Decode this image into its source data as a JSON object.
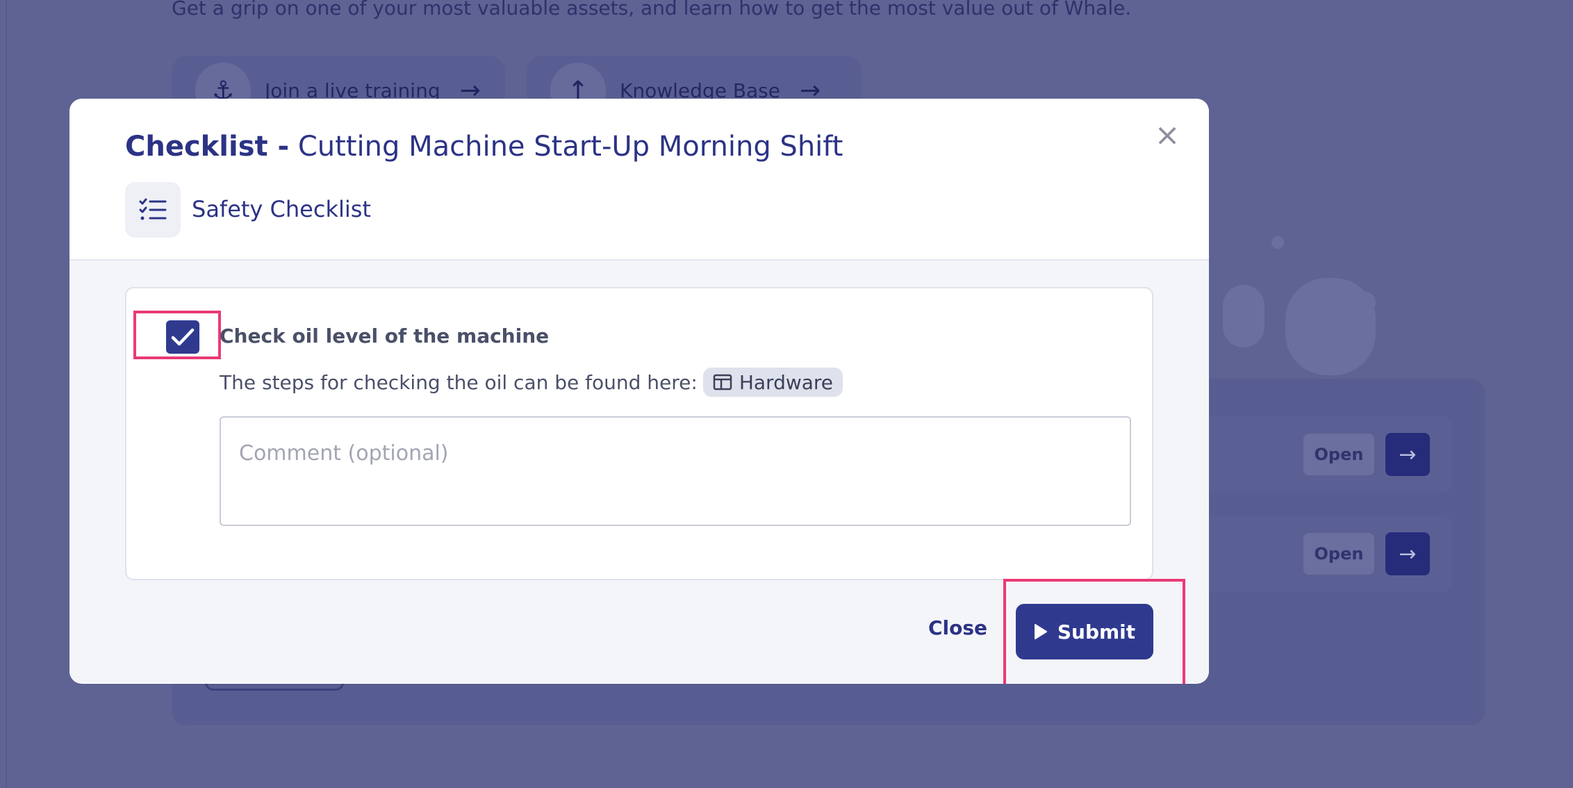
{
  "background": {
    "subtitle": "Get a grip on one of your most valuable assets, and learn how to get the most value out of Whale.",
    "cards": [
      {
        "label": "Join a live training",
        "icon": "anchor-icon"
      },
      {
        "label": "Knowledge Base",
        "icon": "arrow-up-icon"
      }
    ],
    "rows": [
      {
        "open_label": "Open"
      },
      {
        "open_label": "Open"
      }
    ]
  },
  "modal": {
    "title_prefix": "Checklist -",
    "title": "Cutting Machine Start-Up Morning Shift",
    "type_label": "Safety Checklist",
    "type_icon": "checklist-icon",
    "item": {
      "checked": true,
      "title": "Check oil level of the machine",
      "description": "The steps for checking the oil can be found here:",
      "link_label": "Hardware",
      "link_icon": "table-icon",
      "comment_placeholder": "Comment (optional)",
      "comment_value": ""
    },
    "footer": {
      "close_label": "Close",
      "submit_label": "Submit"
    }
  },
  "colors": {
    "primary": "#2f3a8f",
    "highlight": "#ea3a75",
    "overlay": "#5e6394"
  }
}
